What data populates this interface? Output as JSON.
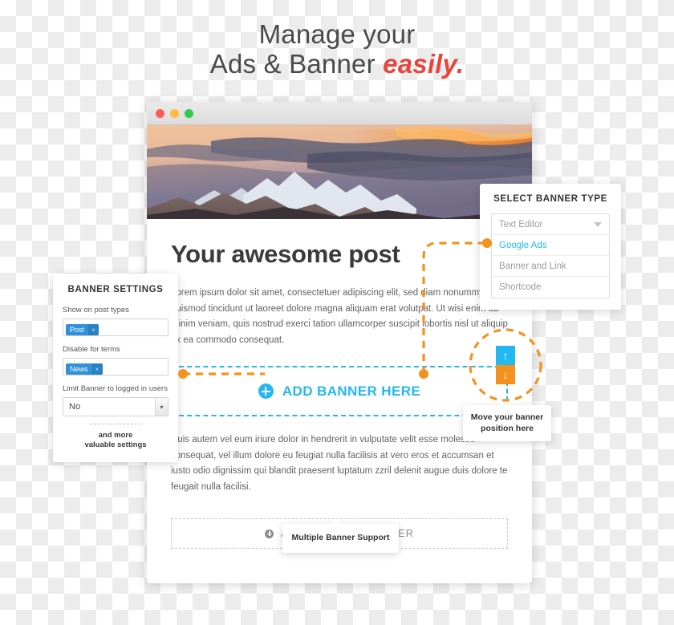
{
  "headline": {
    "line1": "Manage your",
    "line2_plain": "Ads & Banner ",
    "line2_emphasis": "easily."
  },
  "browser": {
    "traffic_lights": [
      "close-red",
      "minimize-yellow",
      "maximize-green"
    ],
    "hero_alt": "mountain-sunset-photo"
  },
  "post": {
    "title": "Your awesome post",
    "paragraph1": "Lorem ipsum dolor sit amet, consectetuer adipiscing elit, sed diam nonummy nibh euismod tincidunt ut laoreet dolore magna aliquam erat volutpat. Ut wisi enim ad minim veniam, quis nostrud exerci tation ullamcorper suscipit lobortis nisl ut aliquip ex ea commodo consequat.",
    "paragraph2": "Duis autem vel eum iriure dolor in hendrerit in vulputate velit esse molestie consequat, vel illum dolore eu feugiat nulla facilisis at vero eros et accumsan et iusto odio dignissim qui blandit praesent luptatum zzril delenit augue duis dolore te feugait nulla facilisi."
  },
  "add_banner": {
    "label": "ADD BANNER HERE",
    "icon": "plus-circle-icon"
  },
  "add_another_banner": {
    "label": "ADD ANOTHER BANNER",
    "icon": "plus-circle-icon"
  },
  "banner_settings": {
    "title": "BANNER SETTINGS",
    "field1_label": "Show on post types",
    "field1_tag": "Post",
    "field1_tag_remove": "×",
    "field2_label": "Disable for terms",
    "field2_tag": "News",
    "field2_tag_remove": "×",
    "field3_label": "Limit Banner to logged in users",
    "field3_value": "No",
    "more_line1": "and more",
    "more_line2": "valuable settings"
  },
  "banner_type": {
    "title": "SELECT BANNER TYPE",
    "options": [
      {
        "label": "Text Editor",
        "selected": false
      },
      {
        "label": "Google Ads",
        "selected": true
      },
      {
        "label": "Banner and Link",
        "selected": false
      },
      {
        "label": "Shortcode",
        "selected": false
      }
    ]
  },
  "move_arrows": {
    "up_icon": "arrow-up-icon",
    "down_icon": "arrow-down-icon",
    "up_glyph": "↑",
    "down_glyph": "↓"
  },
  "tooltips": {
    "move_banner": "Move your banner position here",
    "multiple_banner": "Multiple Banner Support"
  },
  "colors": {
    "accent_blue": "#22b8f0",
    "accent_orange": "#f3921e",
    "tag_blue": "#3191d8",
    "emphasis_red": "#e8453c"
  }
}
